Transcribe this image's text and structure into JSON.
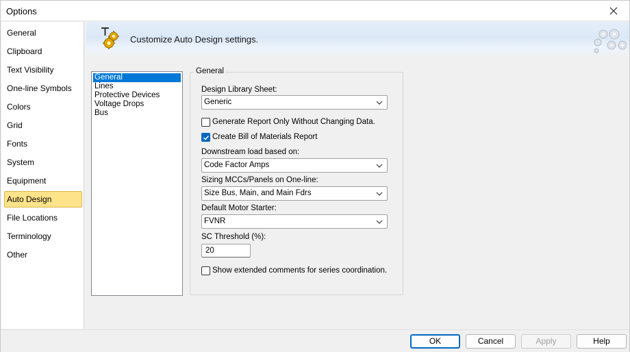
{
  "window": {
    "title": "Options"
  },
  "nav": {
    "items": [
      {
        "label": "General"
      },
      {
        "label": "Clipboard"
      },
      {
        "label": "Text Visibility"
      },
      {
        "label": "One-line Symbols"
      },
      {
        "label": "Colors"
      },
      {
        "label": "Grid"
      },
      {
        "label": "Fonts"
      },
      {
        "label": "System"
      },
      {
        "label": "Equipment"
      },
      {
        "label": "Auto Design",
        "selected": true
      },
      {
        "label": "File Locations"
      },
      {
        "label": "Terminology"
      },
      {
        "label": "Other"
      }
    ]
  },
  "banner": {
    "text": "Customize Auto Design settings.",
    "icon": "auto-design-gear-icon"
  },
  "categories": {
    "items": [
      {
        "label": "General",
        "selected": true
      },
      {
        "label": "Lines"
      },
      {
        "label": "Protective Devices"
      },
      {
        "label": "Voltage Drops"
      },
      {
        "label": "Bus"
      }
    ]
  },
  "group": {
    "title": "General",
    "design_library_label": "Design Library Sheet:",
    "design_library_value": "Generic",
    "report_only_label": "Generate Report Only Without Changing Data.",
    "report_only_checked": false,
    "bom_label": "Create Bill of Materials Report",
    "bom_checked": true,
    "downstream_label": "Downstream load based on:",
    "downstream_value": "Code Factor Amps",
    "sizing_label": "Sizing MCCs/Panels on One-line:",
    "sizing_value": "Size Bus, Main, and Main Fdrs",
    "motor_starter_label": "Default Motor Starter:",
    "motor_starter_value": "FVNR",
    "sc_threshold_label": "SC Threshold (%):",
    "sc_threshold_value": "20",
    "extended_comments_label": "Show extended comments for series coordination.",
    "extended_comments_checked": false
  },
  "footer": {
    "ok": "OK",
    "cancel": "Cancel",
    "apply": "Apply",
    "help": "Help"
  },
  "colors": {
    "selected_nav": "#ffe38a",
    "selected_list": "#0078d7",
    "checkbox_checked": "#0067c0"
  }
}
